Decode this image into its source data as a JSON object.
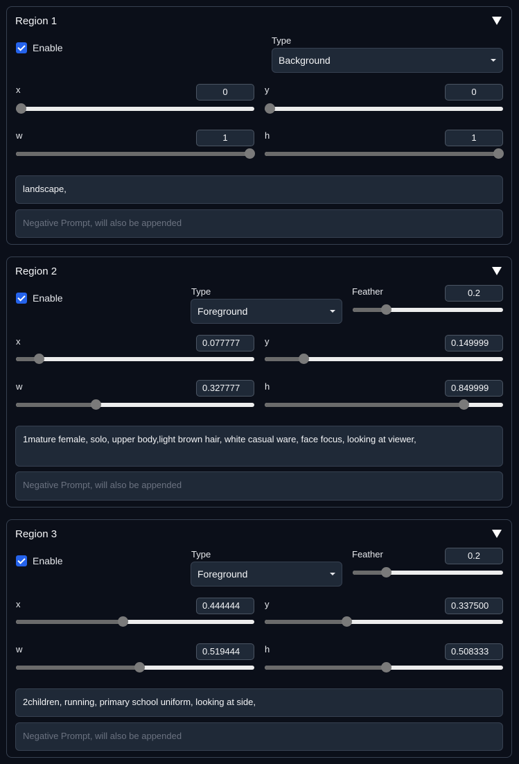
{
  "common": {
    "enable_label": "Enable",
    "type_label": "Type",
    "feather_label": "Feather",
    "x_label": "x",
    "y_label": "y",
    "w_label": "w",
    "h_label": "h",
    "negative_placeholder": "Negative Prompt, will also be appended",
    "collapse_icon": "triangle-down-icon",
    "checkbox_icon": "check-icon"
  },
  "colors": {
    "background": "#0b0f19",
    "panel_border": "#374151",
    "input_bg": "#1f2937",
    "checkbox_accent": "#2563eb",
    "slider_track": "#ededed",
    "slider_fill": "#6b6b6b"
  },
  "regions": [
    {
      "title": "Region 1",
      "enabled": true,
      "type": "Background",
      "x": {
        "value": "0",
        "fraction": 0
      },
      "y": {
        "value": "0",
        "fraction": 0
      },
      "w": {
        "value": "1",
        "fraction": 1
      },
      "h": {
        "value": "1",
        "fraction": 1
      },
      "prompt": "landscape,"
    },
    {
      "title": "Region 2",
      "enabled": true,
      "type": "Foreground",
      "feather": {
        "value": "0.2",
        "fraction": 0.2
      },
      "x": {
        "value": "0.077777",
        "fraction": 0.077777
      },
      "y": {
        "value": "0.149999",
        "fraction": 0.149999
      },
      "w": {
        "value": "0.327777",
        "fraction": 0.327777
      },
      "h": {
        "value": "0.849999",
        "fraction": 0.849999
      },
      "prompt": "1mature female, solo, upper body,light brown hair, white casual ware, face focus, looking at viewer,"
    },
    {
      "title": "Region 3",
      "enabled": true,
      "type": "Foreground",
      "feather": {
        "value": "0.2",
        "fraction": 0.2
      },
      "x": {
        "value": "0.444444",
        "fraction": 0.444444
      },
      "y": {
        "value": "0.337500",
        "fraction": 0.3375
      },
      "w": {
        "value": "0.519444",
        "fraction": 0.519444
      },
      "h": {
        "value": "0.508333",
        "fraction": 0.508333
      },
      "prompt": "2children, running, primary school uniform, looking at side,"
    }
  ]
}
